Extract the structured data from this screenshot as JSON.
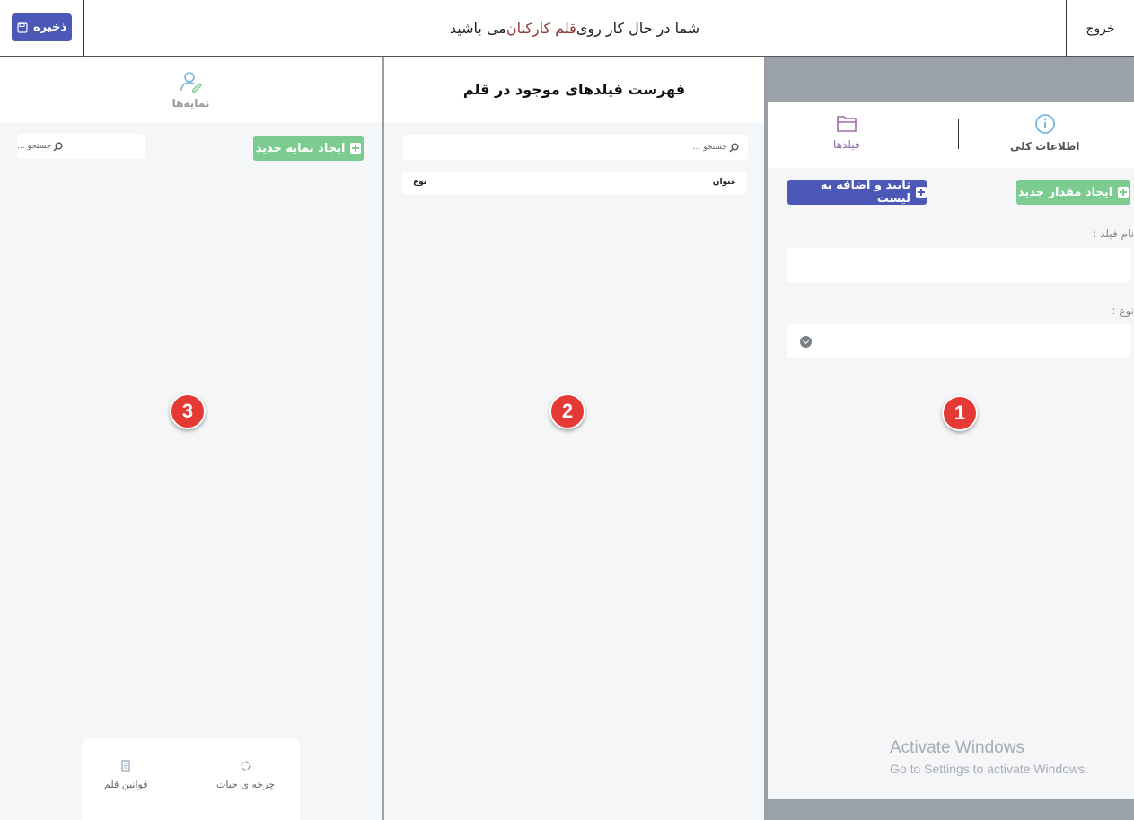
{
  "topbar": {
    "save_label": "ذخیره",
    "title_prefix": "شما در حال کار روی",
    "title_highlight": "قلم کارکنان",
    "title_suffix": "می باشید",
    "exit_label": "خروج"
  },
  "panel3": {
    "badge": "3",
    "header_label": "نمایه‌ها",
    "search_placeholder": "جستجو ...",
    "create_label": "ایجاد نمایه جدید",
    "footer": {
      "lifecycle_label": "چرخه ی حیات",
      "rules_label": "قوانین قلم"
    }
  },
  "panel2": {
    "badge": "2",
    "title": "فهرست فیلدهای موجود در قلم",
    "search_placeholder": "جستجو ...",
    "columns": {
      "title": "عنوان",
      "type": "نوع"
    }
  },
  "panel1": {
    "badge": "1",
    "tabs": {
      "general": "اطلاعات کلی",
      "fields": "فیلدها"
    },
    "create_label": "ایجاد مقدار جدید",
    "confirm_label": "تایید و اضافه به لیست",
    "field_name_label": "نام فیلد :",
    "field_name_value": "",
    "type_label": "نوع :",
    "type_value": ""
  },
  "watermark": {
    "line1": "Activate Windows",
    "line2": "Go to Settings to activate Windows."
  },
  "colors": {
    "primary": "#4b58b8",
    "success": "#7ccb91",
    "highlight": "#8b3a3a",
    "badge": "#e53935"
  }
}
